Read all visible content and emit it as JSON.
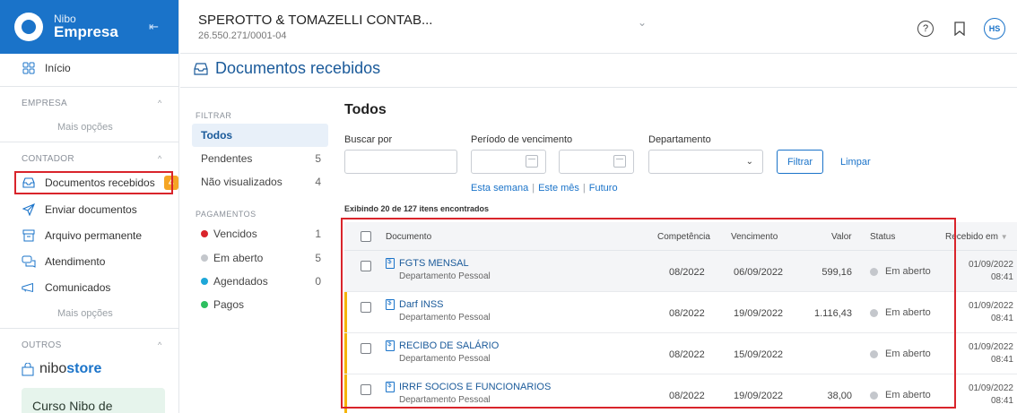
{
  "brand": {
    "small": "Nibo",
    "big": "Empresa"
  },
  "header": {
    "company_name": "SPEROTTO & TOMAZELLI CONTAB...",
    "cnpj": "26.550.271/0001-04",
    "help": "?",
    "avatar": "HS"
  },
  "sidebar": {
    "inicio": "Início",
    "section_empresa": "EMPRESA",
    "empresa_more": "Mais opções",
    "section_contador": "CONTADOR",
    "items": [
      {
        "label": "Documentos recebidos",
        "icon": "inbox-icon",
        "badge": "4"
      },
      {
        "label": "Enviar documentos",
        "icon": "send-icon"
      },
      {
        "label": "Arquivo permanente",
        "icon": "archive-icon"
      },
      {
        "label": "Atendimento",
        "icon": "chat-icon"
      },
      {
        "label": "Comunicados",
        "icon": "megaphone-icon"
      }
    ],
    "contador_more": "Mais opções",
    "section_outros": "OUTROS",
    "store_prefix": "nibo",
    "store_suffix": "store",
    "promo": "Curso Nibo de"
  },
  "page": {
    "title": "Documentos recebidos"
  },
  "filters": {
    "head_filtrar": "FILTRAR",
    "items": [
      {
        "label": "Todos",
        "count": ""
      },
      {
        "label": "Pendentes",
        "count": "5"
      },
      {
        "label": "Não visualizados",
        "count": "4"
      }
    ],
    "head_pagamentos": "PAGAMENTOS",
    "payments": [
      {
        "label": "Vencidos",
        "count": "1",
        "color": "#d9242b"
      },
      {
        "label": "Em aberto",
        "count": "5",
        "color": "#c4c7cc"
      },
      {
        "label": "Agendados",
        "count": "0",
        "color": "#1ea7d8"
      },
      {
        "label": "Pagos",
        "count": "",
        "color": "#2dbf5f"
      }
    ]
  },
  "main": {
    "heading": "Todos",
    "buscar_label": "Buscar por",
    "periodo_label": "Período de vencimento",
    "departamento_label": "Departamento",
    "filtrar": "Filtrar",
    "limpar": "Limpar",
    "quick": [
      "Esta semana",
      "Este mês",
      "Futuro"
    ],
    "quick_sep": "|",
    "showing": "Exibindo 20 de 127 itens encontrados"
  },
  "table": {
    "headers": {
      "documento": "Documento",
      "competencia": "Competência",
      "vencimento": "Vencimento",
      "valor": "Valor",
      "status": "Status",
      "recebido": "Recebido em"
    },
    "rows": [
      {
        "name": "FGTS MENSAL",
        "dept": "Departamento Pessoal",
        "competencia": "08/2022",
        "vencimento": "06/09/2022",
        "valor": "599,16",
        "status": "Em aberto",
        "recebido_date": "01/09/2022",
        "recebido_time": "08:41"
      },
      {
        "name": "Darf INSS",
        "dept": "Departamento Pessoal",
        "competencia": "08/2022",
        "vencimento": "19/09/2022",
        "valor": "1.116,43",
        "status": "Em aberto",
        "recebido_date": "01/09/2022",
        "recebido_time": "08:41"
      },
      {
        "name": "RECIBO DE SALÁRIO",
        "dept": "Departamento Pessoal",
        "competencia": "08/2022",
        "vencimento": "15/09/2022",
        "valor": "",
        "status": "Em aberto",
        "recebido_date": "01/09/2022",
        "recebido_time": "08:41"
      },
      {
        "name": "IRRF SOCIOS E FUNCIONARIOS",
        "dept": "Departamento Pessoal",
        "competencia": "08/2022",
        "vencimento": "19/09/2022",
        "valor": "38,00",
        "status": "Em aberto",
        "recebido_date": "01/09/2022",
        "recebido_time": "08:41"
      }
    ]
  }
}
